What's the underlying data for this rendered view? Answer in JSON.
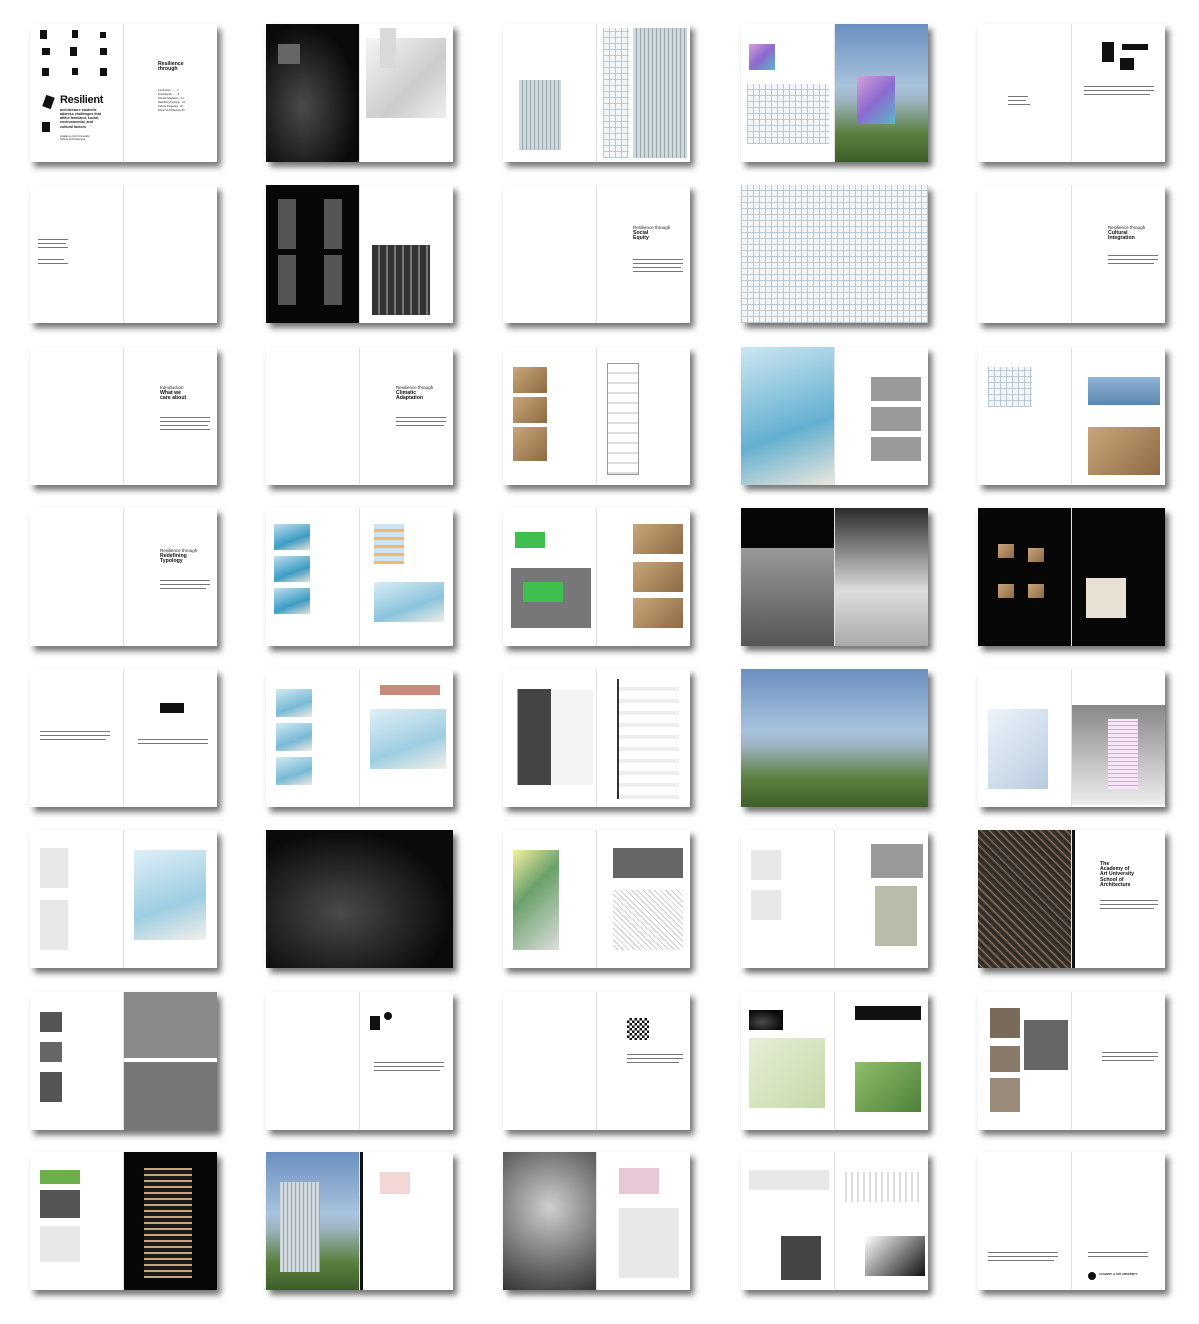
{
  "cover": {
    "title": "Resilient",
    "subtitle": "architecture students\naddress challenges that\naffect farmland, social,\nenvironmental, and\ncultural factors",
    "credit": "Academy of Art University\nSchool of Architecture",
    "contents_heading": "Resilience\nthrough",
    "toc": [
      "Introduction ........ 4",
      "Social Equity ....... 8",
      "Climatic Adaptation .. 12",
      "Redefining Typology .. 16",
      "Cultural Integration . 22",
      "School of Architecture 30"
    ]
  },
  "sections": {
    "social_equity": {
      "pre": "Resilience through",
      "title": "Social\nEquity"
    },
    "cultural_integration": {
      "pre": "Resilience through",
      "title": "Cultural\nIntegration"
    },
    "introduction": {
      "pre": "Introduction",
      "title": "What we\ncare about"
    },
    "climatic_adaptation": {
      "pre": "Resilience through",
      "title": "Climatic\nAdaptation"
    },
    "redefining_typology": {
      "pre": "Resilience through",
      "title": "Redefining\nTypology"
    },
    "school": {
      "title": "The\nAcademy of\nArt University\nSchool of\nArchitecture"
    }
  },
  "footer": {
    "logo_text": "ACADEMY of ART UNIVERSITY"
  },
  "colors": {
    "page": "#ffffff",
    "dark_page": "#070707",
    "ink": "#111111",
    "shadow": "rgba(0,0,0,0.55)"
  }
}
